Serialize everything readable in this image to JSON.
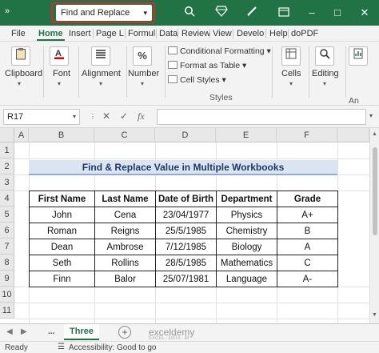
{
  "titlebar": {
    "qat_label": "»",
    "document_title": "Find and Replace Value",
    "window_controls": {
      "minimize": "–",
      "restore": "□",
      "close": "✕"
    },
    "icons": [
      "search-icon",
      "diamond-icon",
      "pen-icon",
      "ribbon-display-icon"
    ]
  },
  "ribbon_tabs": [
    "File",
    "Home",
    "Insert",
    "Page L",
    "Formul",
    "Data",
    "Review",
    "View",
    "Develo",
    "Help",
    "doPDF"
  ],
  "ribbon": {
    "clipboard": "Clipboard",
    "font": "Font",
    "alignment": "Alignment",
    "number": "Number",
    "conditional_formatting": "Conditional Formatting",
    "format_as_table": "Format as Table",
    "cell_styles": "Cell Styles",
    "styles_group": "Styles",
    "cells": "Cells",
    "editing": "Editing",
    "analysis": "An"
  },
  "formula_bar": {
    "name_box": "R17",
    "cancel": "✕",
    "enter": "✓",
    "fx": "fx",
    "value": ""
  },
  "columns": [
    "A",
    "B",
    "C",
    "D",
    "E",
    "F"
  ],
  "rows": [
    "1",
    "2",
    "3",
    "4",
    "5",
    "6",
    "7",
    "8",
    "9",
    "10",
    "11"
  ],
  "sheet": {
    "title": "Find & Replace Value in Multiple Workbooks",
    "headers": [
      "First Name",
      "Last Name",
      "Date of Birth",
      "Department",
      "Grade"
    ],
    "rows": [
      [
        "John",
        "Cena",
        "23/04/1977",
        "Physics",
        "A+"
      ],
      [
        "Roman",
        "Reigns",
        "25/5/1985",
        "Chemistry",
        "B"
      ],
      [
        "Dean",
        "Ambrose",
        "7/12/1985",
        "Biology",
        "A"
      ],
      [
        "Seth",
        "Rollins",
        "28/5/1985",
        "Mathematics",
        "C"
      ],
      [
        "Finn",
        "Balor",
        "25/07/1981",
        "Language",
        "A-"
      ]
    ]
  },
  "sheet_tabs": {
    "ellipsis": "...",
    "active": "Three",
    "add": "+",
    "watermark": "exceldemy",
    "watermark_sub": "EXCEL · DATA · BI"
  },
  "status": {
    "ready": "Ready",
    "accessibility": "Accessibility: Good to go"
  },
  "colors": {
    "accent": "#217346",
    "callout": "#d62828",
    "title_fill": "#dbe5f1",
    "title_text": "#1f3864"
  }
}
